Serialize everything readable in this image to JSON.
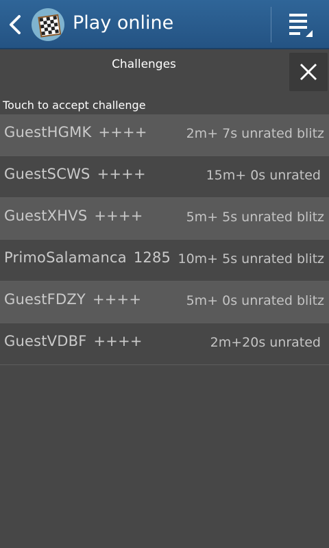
{
  "actionbar": {
    "title": "Play online",
    "back_icon": "chevron-left-icon",
    "logo_icon": "chessboard-icon",
    "menu_icon": "overflow-menu-icon"
  },
  "dialog": {
    "title": "Challenges",
    "close_icon": "close-icon",
    "hint": "Touch to accept challenge"
  },
  "challenges": [
    {
      "name": "GuestHGMK",
      "rating": "++++",
      "time": "2m+ 7s unrated blitz"
    },
    {
      "name": "GuestSCWS",
      "rating": "++++",
      "time": "15m+ 0s unrated"
    },
    {
      "name": "GuestXHVS",
      "rating": "++++",
      "time": "5m+ 5s unrated blitz"
    },
    {
      "name": "PrimoSalamanca",
      "rating": "1285",
      "time": "10m+ 5s unrated blitz"
    },
    {
      "name": "GuestFDZY",
      "rating": "++++",
      "time": "5m+ 0s unrated blitz"
    },
    {
      "name": "GuestVDBF",
      "rating": "++++",
      "time": "2m+20s unrated"
    }
  ],
  "colors": {
    "actionbar": "#2a5d8f",
    "background": "#474747",
    "row_alt": "#5a5a5a"
  }
}
